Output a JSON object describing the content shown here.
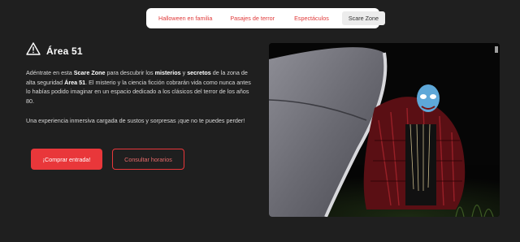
{
  "tabs": [
    {
      "label": "Halloween en familia"
    },
    {
      "label": "Pasajes de terror"
    },
    {
      "label": "Espectáculos"
    },
    {
      "label": "Scare Zone"
    }
  ],
  "section": {
    "icon": "warning-triangle-icon",
    "title": "Área 51",
    "p1": {
      "s1": "Adéntrate en esta ",
      "b1": "Scare Zone",
      "s2": " para descubrir los ",
      "b2": "misterios",
      "s3": " y ",
      "b3": "secretos",
      "s4": " de la zona de alta seguridad ",
      "b4": "Área 51",
      "s5": ". El misterio y la ciencia ficción cobrarán vida como nunca antes lo habías podido imaginar en un espacio dedicado a los clásicos del terror de los años 80."
    },
    "p2": "Una experiencia inmersiva cargada de sustos y sorpresas ¡que no te puedes perder!"
  },
  "buttons": {
    "buy": "¡Comprar entrada!",
    "hours": "Consultar horarios"
  },
  "colors": {
    "accent": "#e9373a",
    "background": "#1f1f1f"
  }
}
